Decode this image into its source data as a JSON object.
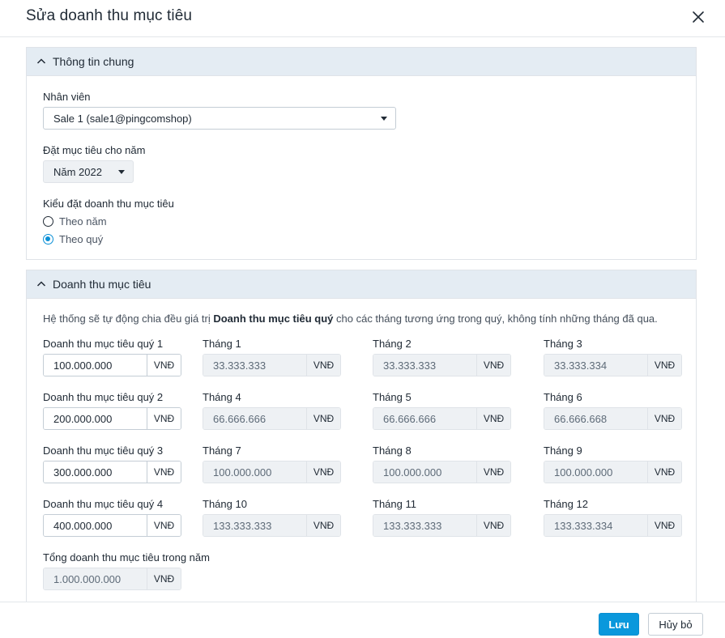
{
  "dialog": {
    "title": "Sửa doanh thu mục tiêu",
    "close_icon": "close-icon"
  },
  "general": {
    "heading": "Thông tin chung",
    "employee_label": "Nhân viên",
    "employee_value": "Sale 1 (sale1@pingcomshop)",
    "year_label": "Đặt mục tiêu cho năm",
    "year_value": "Năm 2022",
    "type_label": "Kiểu đặt doanh thu mục tiêu",
    "type_options": [
      {
        "label": "Theo năm",
        "checked": false
      },
      {
        "label": "Theo quý",
        "checked": true
      }
    ]
  },
  "revenue": {
    "heading": "Doanh thu mục tiêu",
    "note_prefix": "Hệ thống sẽ tự động chia đều giá trị ",
    "note_bold": "Doanh thu mục tiêu quý",
    "note_suffix": " cho các tháng tương ứng trong quý, không tính những tháng đã qua.",
    "unit": "VNĐ",
    "quarters": [
      {
        "label": "Doanh thu mục tiêu quý 1",
        "value": "100.000.000",
        "months": [
          {
            "label": "Tháng 1",
            "value": "33.333.333"
          },
          {
            "label": "Tháng 2",
            "value": "33.333.333"
          },
          {
            "label": "Tháng 3",
            "value": "33.333.334"
          }
        ]
      },
      {
        "label": "Doanh thu mục tiêu quý 2",
        "value": "200.000.000",
        "months": [
          {
            "label": "Tháng 4",
            "value": "66.666.666"
          },
          {
            "label": "Tháng 5",
            "value": "66.666.666"
          },
          {
            "label": "Tháng 6",
            "value": "66.666.668"
          }
        ]
      },
      {
        "label": "Doanh thu mục tiêu quý 3",
        "value": "300.000.000",
        "months": [
          {
            "label": "Tháng 7",
            "value": "100.000.000"
          },
          {
            "label": "Tháng 8",
            "value": "100.000.000"
          },
          {
            "label": "Tháng 9",
            "value": "100.000.000"
          }
        ]
      },
      {
        "label": "Doanh thu mục tiêu quý 4",
        "value": "400.000.000",
        "months": [
          {
            "label": "Tháng 10",
            "value": "133.333.333"
          },
          {
            "label": "Tháng 11",
            "value": "133.333.333"
          },
          {
            "label": "Tháng 12",
            "value": "133.333.334"
          }
        ]
      }
    ],
    "total_label": "Tổng doanh thu mục tiêu trong năm",
    "total_value": "1.000.000.000"
  },
  "footer": {
    "save_label": "Lưu",
    "cancel_label": "Hủy bỏ"
  },
  "colors": {
    "primary": "#0a98dc",
    "section_header": "#e4ecf3",
    "readonly_field": "#eef1f4"
  }
}
